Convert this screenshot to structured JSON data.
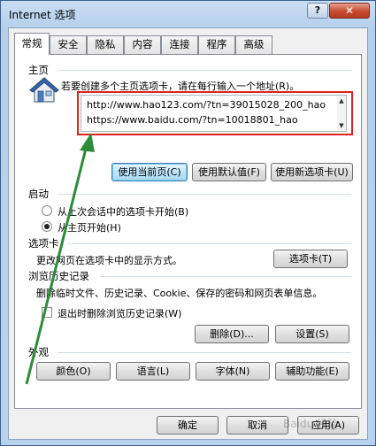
{
  "window": {
    "title": "Internet 选项",
    "help_label": "?",
    "close_label": "✕"
  },
  "tabs": [
    {
      "label": "常规",
      "active": true
    },
    {
      "label": "安全"
    },
    {
      "label": "隐私"
    },
    {
      "label": "内容"
    },
    {
      "label": "连接"
    },
    {
      "label": "程序"
    },
    {
      "label": "高级"
    }
  ],
  "homepage": {
    "section": "主页",
    "description": "若要创建多个主页选项卡，请在每行输入一个地址(R)。",
    "urls": [
      "http://www.hao123.com/?tn=39015028_200_hao",
      "https://www.baidu.com/?tn=10018801_hao"
    ],
    "use_current": "使用当前页(C)",
    "use_default": "使用默认值(F)",
    "use_new_tab": "使用新选项卡(U)"
  },
  "startup": {
    "section": "启动",
    "option_last_session": "从上次会话中的选项卡开始(B)",
    "option_homepage": "从主页开始(H)"
  },
  "tabs_section": {
    "section": "选项卡",
    "description": "更改网页在选项卡中的显示方式。",
    "button": "选项卡(T)"
  },
  "history": {
    "section": "浏览历史记录",
    "description": "删除临时文件、历史记录、Cookie、保存的密码和网页表单信息。",
    "checkbox_label": "退出时删除浏览历史记录(W)",
    "delete_button": "删除(D)...",
    "settings_button": "设置(S)"
  },
  "appearance": {
    "section": "外观",
    "colors": "颜色(O)",
    "languages": "语言(L)",
    "fonts": "字体(N)",
    "accessibility": "辅助功能(E)"
  },
  "footer": {
    "ok": "确定",
    "cancel": "取消",
    "apply": "应用(A)"
  },
  "watermark": "Baidu 经验",
  "colors": {
    "highlight": "#e02020",
    "arrow": "#2e8b3a"
  }
}
